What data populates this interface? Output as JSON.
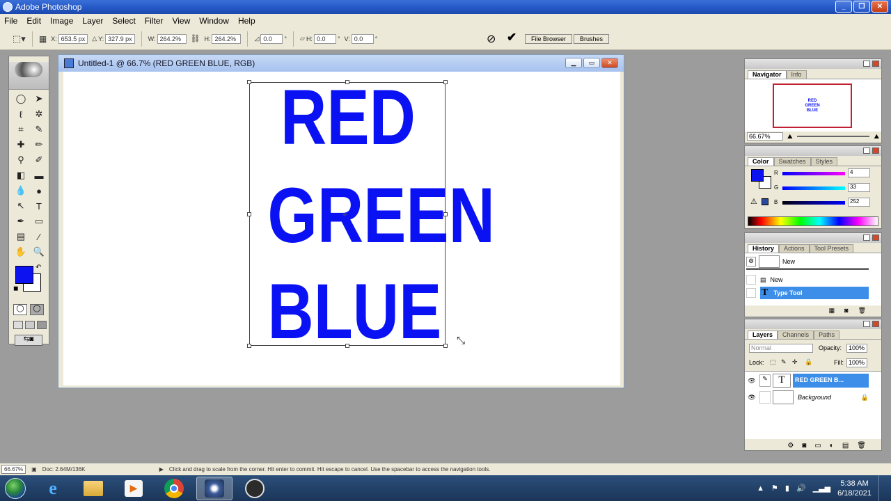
{
  "window": {
    "title": "Adobe Photoshop"
  },
  "menu": [
    "File",
    "Edit",
    "Image",
    "Layer",
    "Select",
    "Filter",
    "View",
    "Window",
    "Help"
  ],
  "options": {
    "x_label": "X:",
    "x_value": "653.5 px",
    "y_label": "Y:",
    "y_value": "327.9 px",
    "w_label": "W:",
    "w_value": "264.2%",
    "h_label": "H:",
    "h_value": "264.2%",
    "angle_value": "0.0",
    "skew_h_label": "H:",
    "skew_h_value": "0.0",
    "skew_v_label": "V:",
    "skew_v_value": "0.0"
  },
  "wells": [
    "File Browser",
    "Brushes"
  ],
  "document": {
    "title": "Untitled-1 @ 66.7% (RED GREEN BLUE, RGB)",
    "lines": [
      "RED",
      "GREEN",
      "BLUE"
    ],
    "text_color": "#0a12f4"
  },
  "colors": {
    "foreground": "#0c12f0",
    "background": "#ffffff"
  },
  "navigator": {
    "tabs": [
      "Navigator",
      "Info"
    ],
    "zoom": "66.67%",
    "thumb_lines": [
      "RED",
      "GREEN",
      "BLUE"
    ]
  },
  "color_panel": {
    "tabs": [
      "Color",
      "Swatches",
      "Styles"
    ],
    "r_label": "R",
    "r": "4",
    "g_label": "G",
    "g": "33",
    "b_label": "B",
    "b": "252"
  },
  "history": {
    "tabs": [
      "History",
      "Actions",
      "Tool Presets"
    ],
    "snapshot": "New",
    "items": [
      "New",
      "Type Tool"
    ]
  },
  "layers": {
    "tabs": [
      "Layers",
      "Channels",
      "Paths"
    ],
    "blend": "Normal",
    "opacity_label": "Opacity:",
    "opacity": "100%",
    "lock_label": "Lock:",
    "fill_label": "Fill:",
    "fill": "100%",
    "items": [
      {
        "name": "RED GREEN B...",
        "selected": true
      },
      {
        "name": "Background",
        "selected": false
      }
    ]
  },
  "status": {
    "zoom": "66.67%",
    "doc": "Doc: 2.64M/136K",
    "hint": "Click and drag to scale from the corner. Hit enter to commit. Hit escape to cancel. Use the spacebar to access the navigation tools."
  },
  "taskbar": {
    "time": "5:38 AM",
    "date": "6/18/2021"
  }
}
